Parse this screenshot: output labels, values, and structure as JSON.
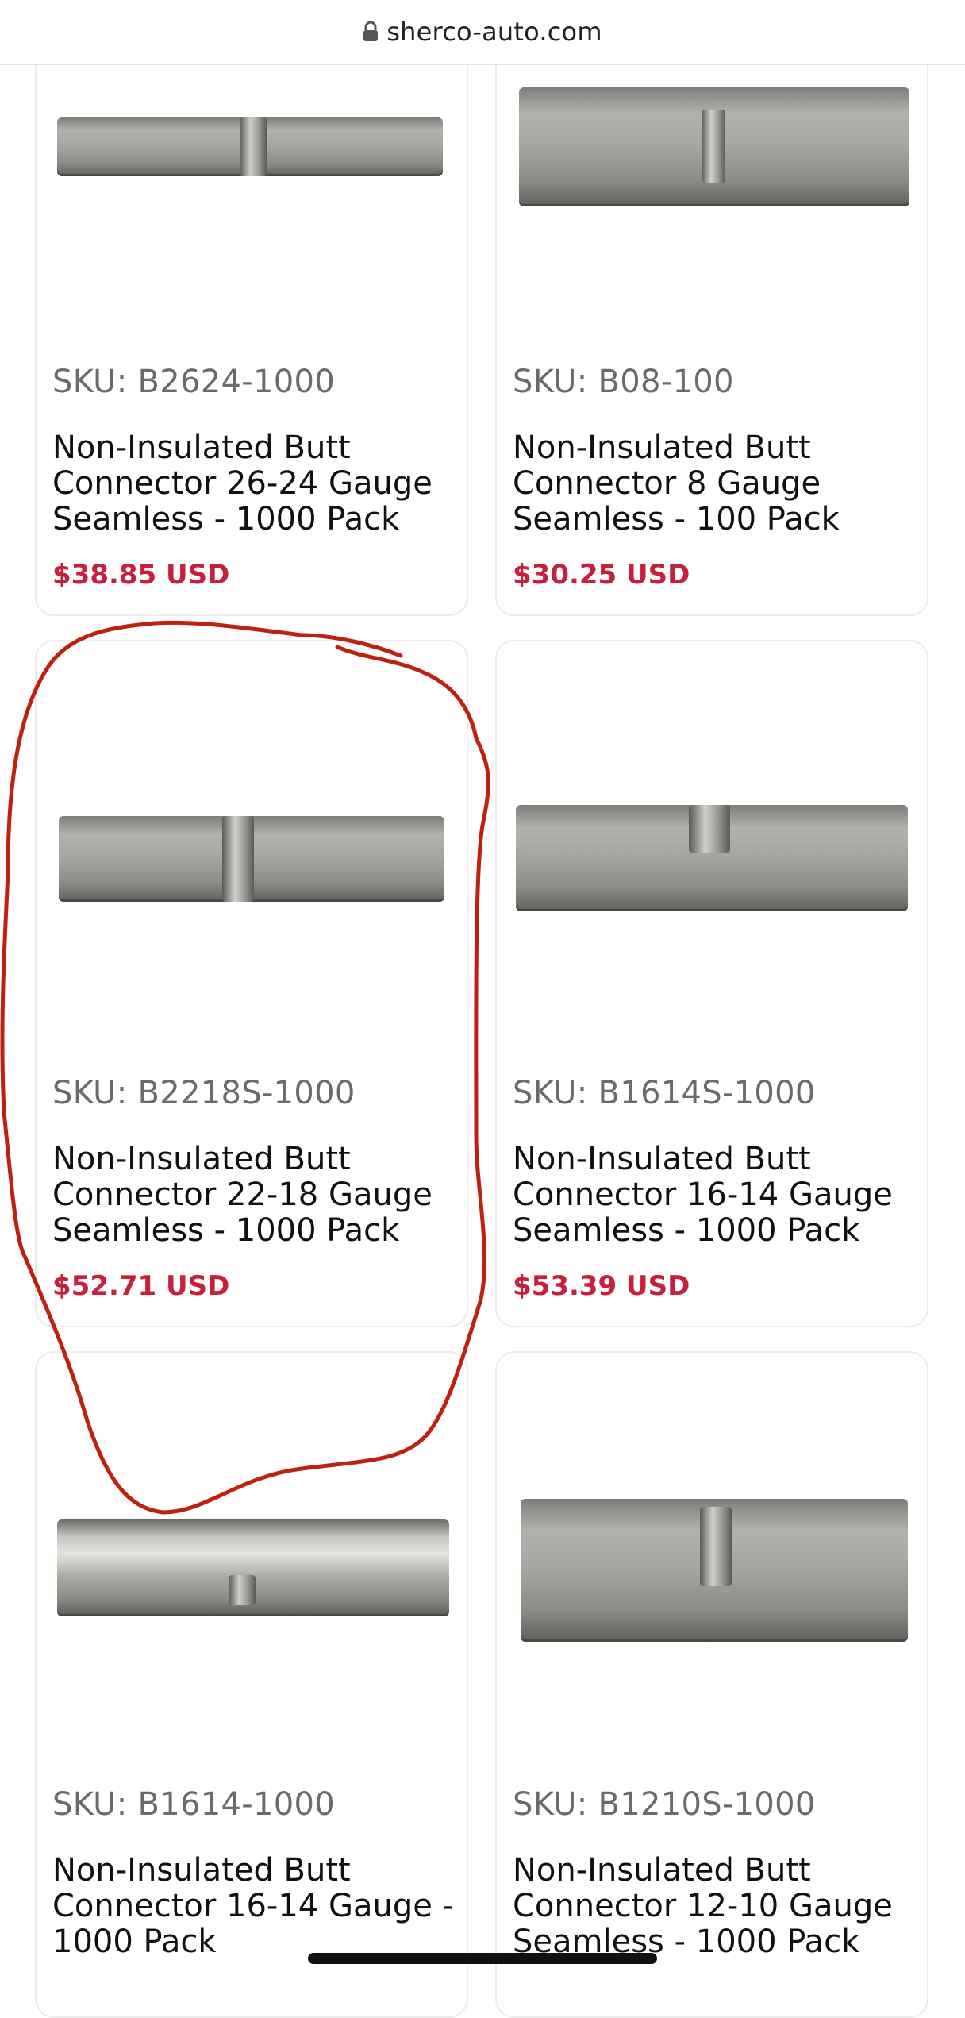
{
  "browser": {
    "url": "sherco-auto.com"
  },
  "products": [
    {
      "sku": "SKU: B2624-1000",
      "title": "Non-Insulated Butt Connector 26-24 Gauge Seamless - 1000 Pack",
      "price": "$38.85 USD",
      "image_name": "butt-connector-image"
    },
    {
      "sku": "SKU: B08-100",
      "title": "Non-Insulated Butt Connector 8 Gauge Seamless - 100 Pack",
      "price": "$30.25 USD",
      "image_name": "butt-connector-image"
    },
    {
      "sku": "SKU: B2218S-1000",
      "title": "Non-Insulated Butt Connector 22-18 Gauge Seamless - 1000 Pack",
      "price": "$52.71 USD",
      "image_name": "butt-connector-image"
    },
    {
      "sku": "SKU: B1614S-1000",
      "title": "Non-Insulated Butt Connector 16-14 Gauge Seamless - 1000 Pack",
      "price": "$53.39 USD",
      "image_name": "butt-connector-image"
    },
    {
      "sku": "SKU: B1614-1000",
      "title": "Non-Insulated Butt Connector 16-14 Gauge - 1000 Pack",
      "price": "",
      "image_name": "butt-connector-image"
    },
    {
      "sku": "SKU: B1210S-1000",
      "title": "Non-Insulated Butt Connector 12-10 Gauge Seamless - 1000 Pack",
      "price": "",
      "image_name": "butt-connector-image"
    }
  ],
  "colors": {
    "price": "#c8203a",
    "sku": "#6b6b6b",
    "annotation_stroke": "#c0210f",
    "card_border": "#ececec"
  },
  "annotation": {
    "type": "hand-drawn circle",
    "target": "SKU: B2218S-1000"
  }
}
